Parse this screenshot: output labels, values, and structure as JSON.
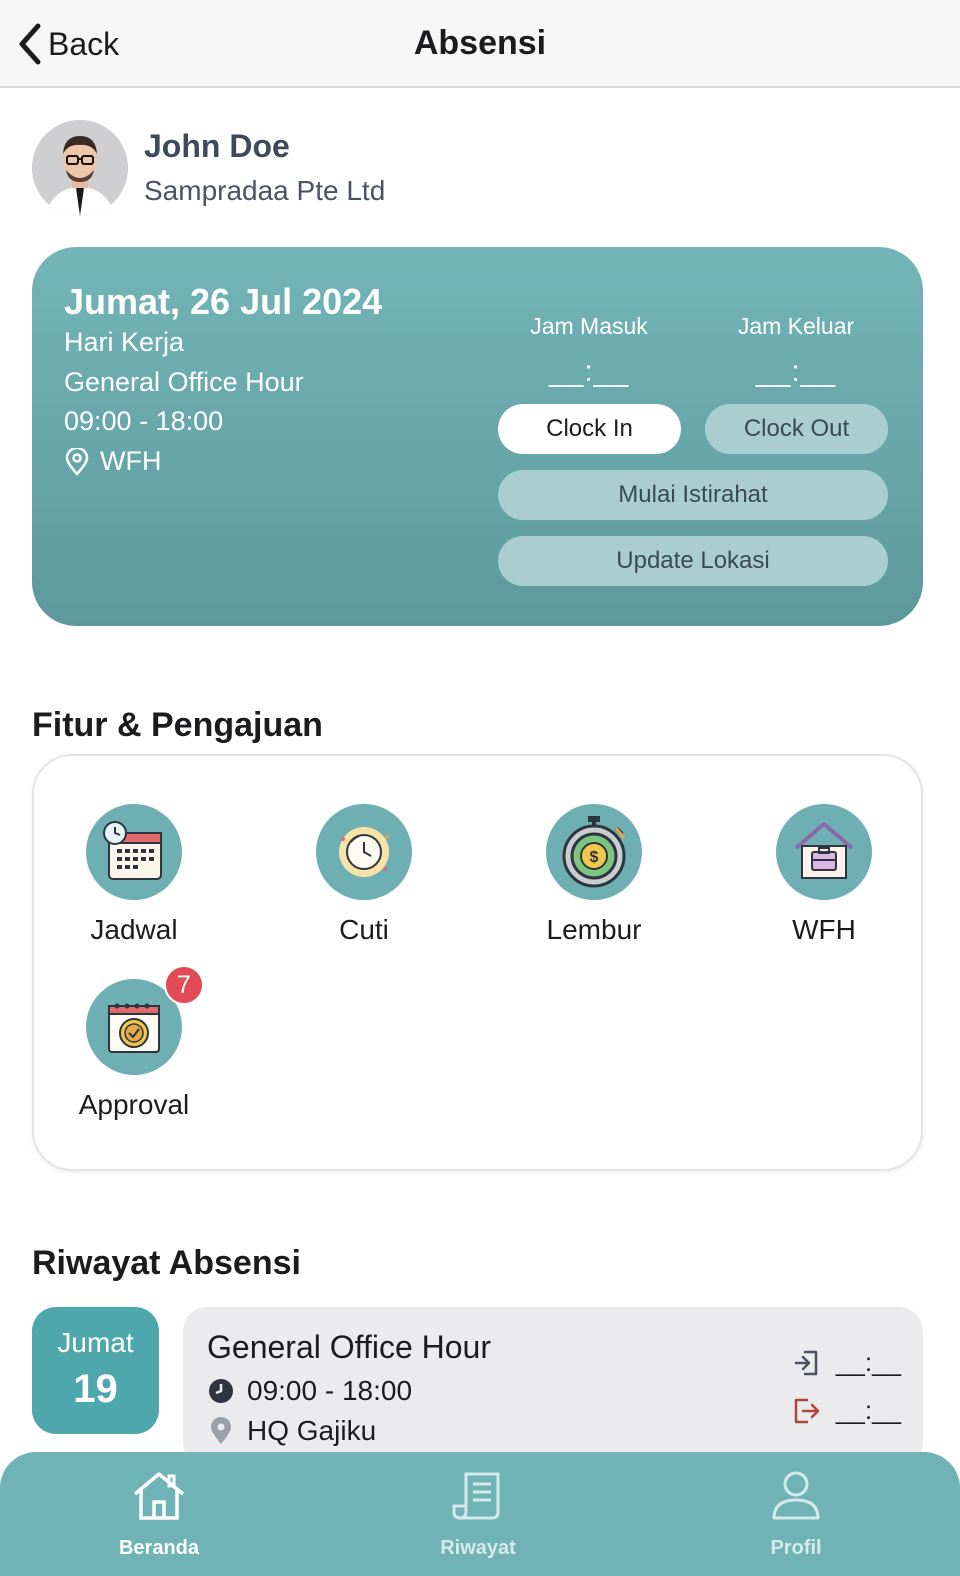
{
  "header": {
    "back_label": "Back",
    "title": "Absensi"
  },
  "profile": {
    "name": "John Doe",
    "company": "Sampradaa Pte Ltd"
  },
  "attendance": {
    "date": "Jumat, 26 Jul 2024",
    "day_type": "Hari Kerja",
    "shift": "General Office Hour",
    "hours": "09:00 - 18:00",
    "location": "WFH",
    "clock_in_label": "Jam Masuk",
    "clock_in_time": "__:__",
    "clock_out_label": "Jam Keluar",
    "clock_out_time": "__:__",
    "clock_in_button": "Clock In",
    "clock_out_button": "Clock Out",
    "break_button": "Mulai Istirahat",
    "update_location_button": "Update Lokasi"
  },
  "features": {
    "title": "Fitur & Pengajuan",
    "items": [
      {
        "label": "Jadwal",
        "icon": "calendar-clock-icon"
      },
      {
        "label": "Cuti",
        "icon": "leave-clock-icon"
      },
      {
        "label": "Lembur",
        "icon": "overtime-stopwatch-icon"
      },
      {
        "label": "WFH",
        "icon": "home-briefcase-icon"
      },
      {
        "label": "Approval",
        "icon": "approval-calendar-icon",
        "badge": "7"
      }
    ]
  },
  "history": {
    "title": "Riwayat Absensi",
    "entries": [
      {
        "day_name": "Jumat",
        "day_num": "19",
        "shift": "General Office Hour",
        "hours": "09:00 - 18:00",
        "location": "HQ Gajiku",
        "in_time": "__:__",
        "out_time": "__:__"
      }
    ]
  },
  "nav": {
    "items": [
      {
        "label": "Beranda",
        "icon": "home-icon",
        "active": true
      },
      {
        "label": "Riwayat",
        "icon": "document-icon",
        "active": false
      },
      {
        "label": "Profil",
        "icon": "user-icon",
        "active": false
      }
    ]
  },
  "colors": {
    "accent": "#6fb3b7",
    "card_top": "#73b5b8",
    "card_bottom": "#5c999c",
    "badge": "#e04b55",
    "muted_pill": "#aacdcf"
  }
}
